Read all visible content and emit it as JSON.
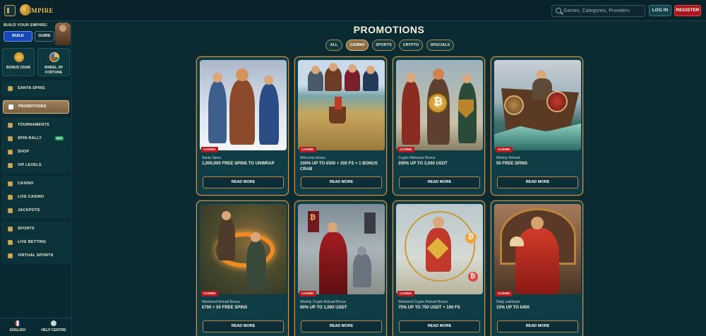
{
  "header": {
    "logo_text": "EMPIRE",
    "search_placeholder": "Games, Categories, Providers",
    "login_label": "LOG IN",
    "register_label": "REGISTER"
  },
  "sidebar": {
    "build_title": "BUILD YOUR EMPIRE!",
    "build_button": "BUILD",
    "guide_button": "GUIDE",
    "tiles": [
      {
        "label": "BONUS CRAB"
      },
      {
        "label": "WHEEL OF FORTUNE"
      }
    ],
    "groups": [
      [
        {
          "label": "SANTA SPINS",
          "icon": "gift-icon"
        }
      ],
      [
        {
          "label": "PROMOTIONS",
          "icon": "promotions-icon",
          "active": true
        }
      ],
      [
        {
          "label": "TOURNAMENTS",
          "icon": "trophy-icon"
        },
        {
          "label": "SPIN RALLY",
          "icon": "rally-icon",
          "badge": "NEW"
        },
        {
          "label": "SHOP",
          "icon": "shop-icon"
        },
        {
          "label": "VIP LEVELS",
          "icon": "crown-icon"
        }
      ],
      [
        {
          "label": "CASINO",
          "icon": "casino-icon"
        },
        {
          "label": "LIVE CASINO",
          "icon": "live-casino-icon"
        },
        {
          "label": "JACKPOTS",
          "icon": "jackpot-icon"
        }
      ],
      [
        {
          "label": "SPORTS",
          "icon": "sports-icon"
        },
        {
          "label": "LIVE BETTING",
          "icon": "live-betting-icon"
        },
        {
          "label": "VIRTUAL SPORTS",
          "icon": "virtual-sports-icon"
        }
      ]
    ],
    "bottom": {
      "language": "ENGLISH",
      "help": "HELP CENTRE"
    }
  },
  "main": {
    "title": "PROMOTIONS",
    "tabs": [
      {
        "label": "ALL"
      },
      {
        "label": "CASINO",
        "active": true
      },
      {
        "label": "SPORTS"
      },
      {
        "label": "CRYPTO"
      },
      {
        "label": "SPECIALS"
      }
    ],
    "cards": [
      {
        "tag": "CASINO",
        "subtitle": "Santa Spins",
        "headline": "1,000,000 FREE SPINS TO UNWRAP",
        "button": "READ MORE",
        "theme": "snow"
      },
      {
        "tag": "CASINO",
        "subtitle": "Welcome bonus",
        "headline": "100% UP TO €500 + 200 FS + 1 BONUS CRAB",
        "button": "READ MORE",
        "theme": "map"
      },
      {
        "tag": "CASINO",
        "subtitle": "Crypto Welcome Bonus",
        "headline": "200% UP TO 3,000 USDT",
        "button": "READ MORE",
        "theme": "crypto"
      },
      {
        "tag": "CASINO",
        "subtitle": "Weekly Reload",
        "headline": "50 FREE SPINS",
        "button": "READ MORE",
        "theme": "ship"
      },
      {
        "tag": "CASINO",
        "subtitle": "Weekend Reload Bonus",
        "headline": "€700 + 50 FREE SPINS",
        "button": "READ MORE",
        "theme": "fire"
      },
      {
        "tag": "CASINO",
        "subtitle": "Weekly Crypto Reload Bonus",
        "headline": "60% UP TO 1,000 USDT",
        "button": "READ MORE",
        "theme": "queen"
      },
      {
        "tag": "CASINO",
        "subtitle": "Weekend Crypto Reload Bonus",
        "headline": "75% UP TO 750 USDT + 100 FS",
        "button": "READ MORE",
        "theme": "warrior"
      },
      {
        "tag": "CASINO",
        "subtitle": "Daily cashback",
        "headline": "15% UP TO €400",
        "button": "READ MORE",
        "theme": "emperor"
      }
    ]
  }
}
